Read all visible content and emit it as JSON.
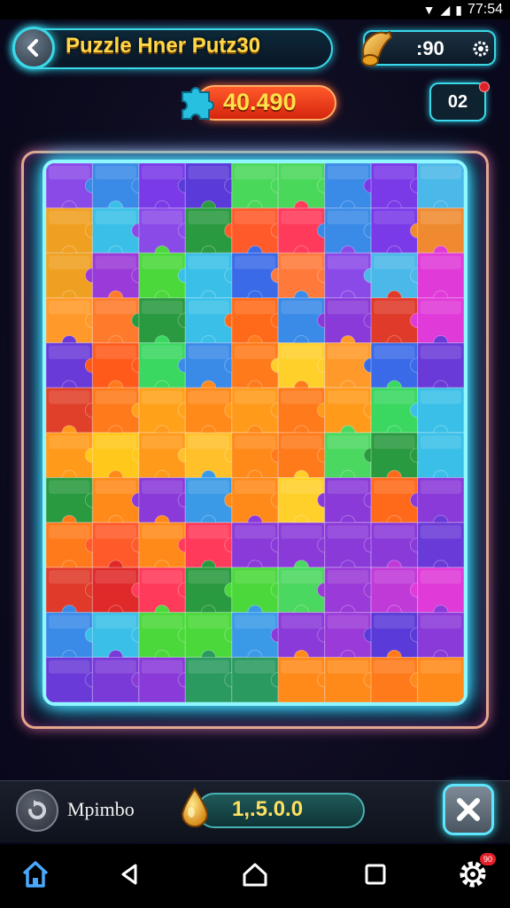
{
  "status_bar": {
    "time": "77:54"
  },
  "header": {
    "title": "Puzzle Hner Putz30",
    "coin_value": ":90",
    "score": "40.490",
    "badge": "02"
  },
  "board": {
    "rows": 12,
    "cols": 9,
    "piece_colors": [
      [
        "#8a4ae8",
        "#3a8ae8",
        "#7a3ae8",
        "#5a3ad8",
        "#4ad85a",
        "#4ad85a",
        "#3a8ae8",
        "#7a3ae8",
        "#4ab8e8"
      ],
      [
        "#f0a020",
        "#3ac0e8",
        "#8a4ae8",
        "#2a9a40",
        "#ff5a2a",
        "#ff3a5a",
        "#3a8ae8",
        "#7a3ae8",
        "#f08a30"
      ],
      [
        "#f0a020",
        "#9a3ad8",
        "#4ad83a",
        "#3ac0e8",
        "#3a6ae8",
        "#ff7a3a",
        "#8a4ae8",
        "#4ab8e8",
        "#e03ad8"
      ],
      [
        "#ff9a2a",
        "#ff7a2a",
        "#2a9a40",
        "#3ac0e8",
        "#ff6a1a",
        "#3a8ae8",
        "#8a3ad8",
        "#e03a2a",
        "#e03ad8"
      ],
      [
        "#6a3ad8",
        "#ff5a1a",
        "#3ad860",
        "#3a8ae8",
        "#ff7a1a",
        "#ffd02a",
        "#ff9a2a",
        "#3a6ae8",
        "#6a3ad8"
      ],
      [
        "#e0402a",
        "#ff7a1a",
        "#ffa21a",
        "#ff8a1a",
        "#ff9a1a",
        "#ff7a1a",
        "#ff9a1a",
        "#3ad860",
        "#3ac0e8"
      ],
      [
        "#ff9a1a",
        "#ffc81a",
        "#ff9a1a",
        "#ffc02a",
        "#ff8a1a",
        "#ff7a1a",
        "#4ad860",
        "#2a9a40",
        "#3ac0e8"
      ],
      [
        "#2a9a40",
        "#ff8a1a",
        "#8a3ad8",
        "#3a9ae8",
        "#ff8a1a",
        "#ffd02a",
        "#8a3ad8",
        "#ff6a1a",
        "#8a3ad8"
      ],
      [
        "#ff7a1a",
        "#ff5a2a",
        "#ff8a1a",
        "#ff3a5a",
        "#8a3ad8",
        "#8a3ad8",
        "#8a3ad8",
        "#8a3ad8",
        "#6a3ad8"
      ],
      [
        "#e03a2a",
        "#e02a2a",
        "#ff3a5a",
        "#2a9a40",
        "#4ad83a",
        "#4ad860",
        "#9a3ad8",
        "#c03ad8",
        "#e03ad8"
      ],
      [
        "#3a8ae8",
        "#3ac0e8",
        "#4ad83a",
        "#4ad83a",
        "#3a9ae8",
        "#8a3ad8",
        "#9a3ad8",
        "#5a3ad8",
        "#8a3ad8"
      ],
      [
        "#6a3ad8",
        "#7a3ad8",
        "#8a3ad8",
        "#2a9a60",
        "#2a9a60",
        "#ff8a1a",
        "#ff8a1a",
        "#ff7a1a",
        "#ff8a1a"
      ]
    ]
  },
  "bottom": {
    "mode_label": "Mpimbo",
    "gem_value": "1,.5.0.0"
  },
  "nav": {
    "settings_badge": "90"
  }
}
